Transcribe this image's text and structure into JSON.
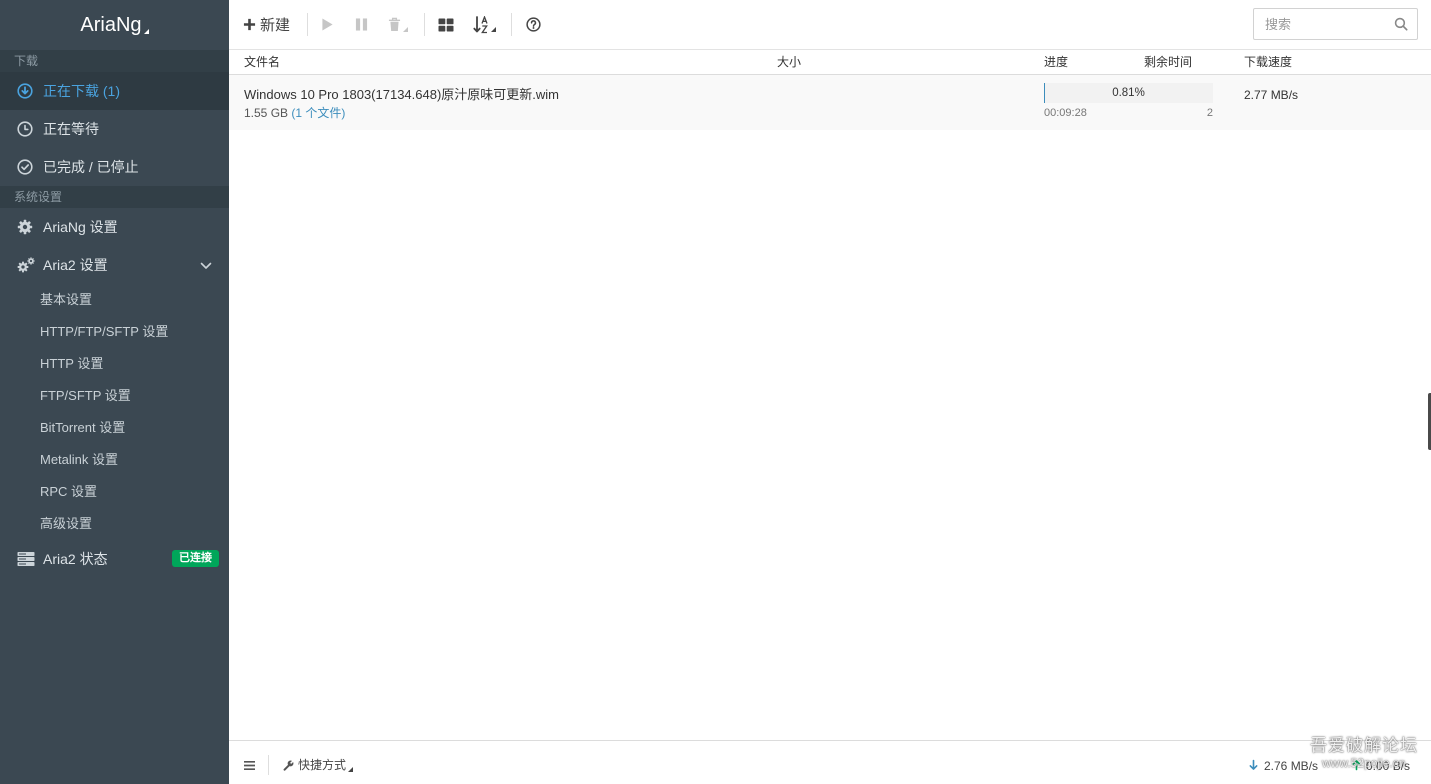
{
  "app": {
    "logo": "AriaNg"
  },
  "sidebar": {
    "download_header": "下载",
    "download_items": [
      {
        "label": "正在下载 (1)",
        "icon": "arrow-circle-down-icon",
        "active": true
      },
      {
        "label": "正在等待",
        "icon": "clock-icon",
        "active": false
      },
      {
        "label": "已完成 / 已停止",
        "icon": "check-circle-icon",
        "active": false
      }
    ],
    "settings_header": "系统设置",
    "settings_items": [
      {
        "label": "AriaNg 设置",
        "icon": "gear-icon"
      },
      {
        "label": "Aria2 设置",
        "icon": "gears-icon",
        "expanded": true
      }
    ],
    "aria2_sub_items": [
      "基本设置",
      "HTTP/FTP/SFTP 设置",
      "HTTP 设置",
      "FTP/SFTP 设置",
      "BitTorrent 设置",
      "Metalink 设置",
      "RPC 设置",
      "高级设置"
    ],
    "status_item": {
      "label": "Aria2 状态",
      "icon": "server-icon",
      "badge": "已连接"
    }
  },
  "toolbar": {
    "new_label": "新建",
    "buttons": [
      {
        "icon": "plus-icon",
        "enabled": true
      },
      {
        "icon": "play-icon",
        "enabled": false
      },
      {
        "icon": "pause-icon",
        "enabled": false
      },
      {
        "icon": "trash-icon",
        "enabled": false
      },
      {
        "icon": "grid-icon",
        "enabled": true
      },
      {
        "icon": "sort-alpha-icon",
        "enabled": true
      },
      {
        "icon": "question-circle-icon",
        "enabled": true
      }
    ],
    "search_placeholder": "搜索",
    "search_value": ""
  },
  "task_table": {
    "columns": {
      "name": "文件名",
      "size": "大小",
      "progress": "进度",
      "remaining": "剩余时间",
      "speed": "下载速度"
    },
    "tasks": [
      {
        "name": "Windows 10 Pro 1803(17134.648)原汁原味可更新.wim",
        "size": "1.55 GB",
        "files": "(1 个文件)",
        "progress_percent": 0.81,
        "progress_text": "0.81%",
        "remaining": "00:09:28",
        "connections": "2",
        "speed": "2.77 MB/s"
      }
    ]
  },
  "footer": {
    "menu_icon": "bars-icon",
    "shortcuts_label": "快捷方式",
    "download_speed": "2.76 MB/s",
    "upload_speed": "0.00 B/s"
  },
  "watermark": {
    "line1": "吾爱破解论坛",
    "line2": "www.52pojie.cn"
  },
  "colors": {
    "sidebar_bg": "#3b4852",
    "accent": "#3c8dbc",
    "connected_badge": "#00a65a",
    "download_arrow": "#3c8dbc",
    "upload_arrow": "#00a65a"
  }
}
